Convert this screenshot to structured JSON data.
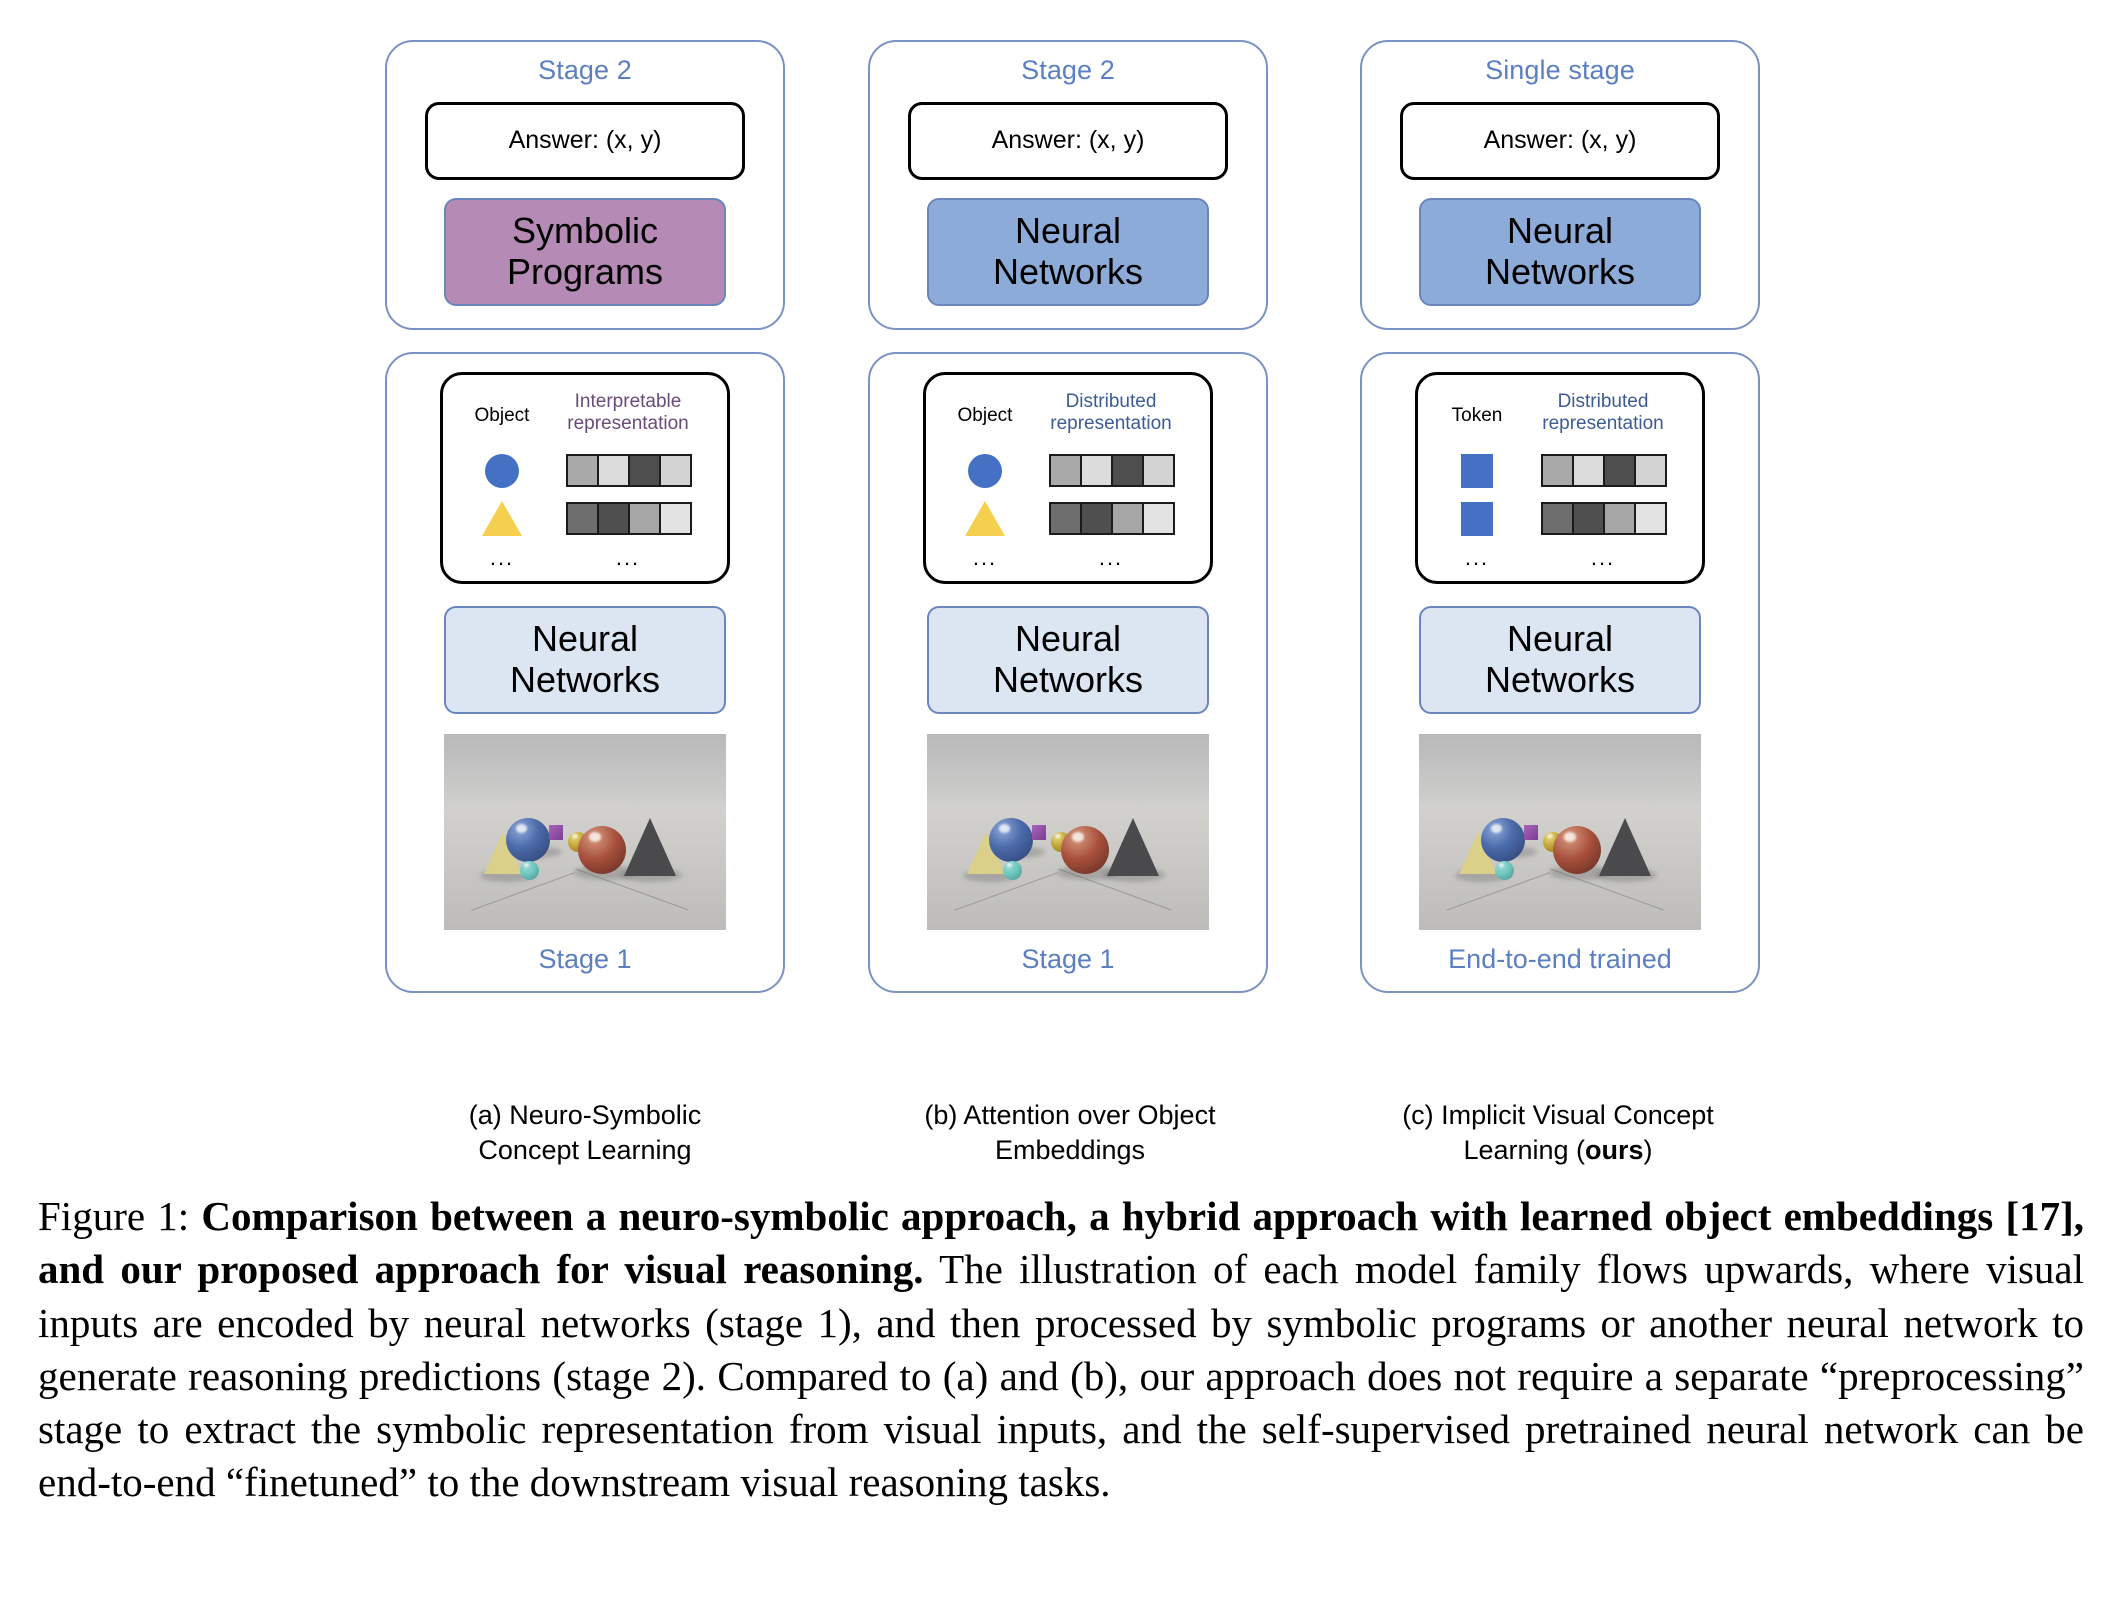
{
  "figure": {
    "label": "Figure 1:",
    "caption_bold": "Comparison between a neuro-symbolic approach, a hybrid approach with learned object embeddings [17], and our proposed approach for visual reasoning.",
    "caption_rest": " The illustration of each model family flows upwards, where visual inputs are encoded by neural networks (stage 1), and then processed by symbolic programs or another neural network to generate reasoning predictions (stage 2). Compared to (a) and (b), our approach does not require a separate “preprocessing” stage to extract the symbolic representation from visual inputs, and the self-supervised pretrained neural network can be end-to-end “finetuned” to the downstream visual reasoning tasks."
  },
  "colors": {
    "stage_label": "#5b7fc0",
    "outer_border": "#7a93c4",
    "symbolic_fill": "#b58ab4",
    "neural_dark_fill": "#8cabd9",
    "neural_light_fill": "#dce6f3",
    "interpretable_text": "#6b4b78",
    "distributed_text": "#3c5c93",
    "token_blue": "#4471c4",
    "object_circle": "#4471c4",
    "object_triangle": "#f5cf4e"
  },
  "panels": [
    {
      "id": "a",
      "top_stage_label": "Stage 2",
      "answer_label": "Answer: (x, y)",
      "processor_label": "Symbolic\nPrograms",
      "processor_line1": "Symbolic",
      "processor_line2": "Programs",
      "repr_col_left_header": "Object",
      "repr_col_right_header_line1": "Interpretable",
      "repr_col_right_header_line2": "representation",
      "object_glyphs": [
        "circle",
        "triangle"
      ],
      "repr_rows": [
        [
          "#a9a9a9",
          "#dcdcdc",
          "#4e4e4e",
          "#d3d3d3"
        ],
        [
          "#6e6e6e",
          "#4f4f4f",
          "#a6a6a6",
          "#e3e3e3"
        ]
      ],
      "ellipsis_left": "...",
      "ellipsis_right": "...",
      "encoder_line1": "Neural",
      "encoder_line2": "Networks",
      "bottom_stage_label": "Stage 1",
      "subcaption_line1": "(a) Neuro-Symbolic",
      "subcaption_line2": "Concept Learning",
      "subcaption_bold_tail": ""
    },
    {
      "id": "b",
      "top_stage_label": "Stage 2",
      "answer_label": "Answer: (x, y)",
      "processor_label": "Neural\nNetworks",
      "processor_line1": "Neural",
      "processor_line2": "Networks",
      "repr_col_left_header": "Object",
      "repr_col_right_header_line1": "Distributed",
      "repr_col_right_header_line2": "representation",
      "object_glyphs": [
        "circle",
        "triangle"
      ],
      "repr_rows": [
        [
          "#a9a9a9",
          "#dcdcdc",
          "#4e4e4e",
          "#d3d3d3"
        ],
        [
          "#6e6e6e",
          "#4f4f4f",
          "#a6a6a6",
          "#e3e3e3"
        ]
      ],
      "ellipsis_left": "...",
      "ellipsis_right": "...",
      "encoder_line1": "Neural",
      "encoder_line2": "Networks",
      "bottom_stage_label": "Stage 1",
      "subcaption_line1": "(b) Attention over Object",
      "subcaption_line2": "Embeddings",
      "subcaption_bold_tail": ""
    },
    {
      "id": "c",
      "top_stage_label": "Single stage",
      "answer_label": "Answer: (x, y)",
      "processor_label": "Neural\nNetworks",
      "processor_line1": "Neural",
      "processor_line2": "Networks",
      "repr_col_left_header": "Token",
      "repr_col_right_header_line1": "Distributed",
      "repr_col_right_header_line2": "representation",
      "object_glyphs": [
        "square",
        "square"
      ],
      "repr_rows": [
        [
          "#a9a9a9",
          "#dcdcdc",
          "#4e4e4e",
          "#d3d3d3"
        ],
        [
          "#6e6e6e",
          "#4f4f4f",
          "#a6a6a6",
          "#e3e3e3"
        ]
      ],
      "ellipsis_left": "...",
      "ellipsis_right": "...",
      "encoder_line1": "Neural",
      "encoder_line2": "Networks",
      "bottom_stage_label": "End-to-end trained",
      "subcaption_line1": "(c) Implicit Visual Concept",
      "subcaption_line2": "Learning (",
      "subcaption_bold_tail": "ours",
      "subcaption_line2_end": ")"
    }
  ],
  "scene": {
    "name": "clevr-scene",
    "objects": [
      {
        "name": "yellow-cone",
        "color": "#d9cf84"
      },
      {
        "name": "blue-metal-sphere",
        "color": "#4a6aa8"
      },
      {
        "name": "purple-small-cube",
        "color": "#8d4aa0"
      },
      {
        "name": "gold-small-sphere",
        "color": "#c2a535"
      },
      {
        "name": "cyan-small-sphere",
        "color": "#6fc6c0"
      },
      {
        "name": "copper-metal-sphere",
        "color": "#a8503c"
      },
      {
        "name": "gray-metal-cone",
        "color": "#4a4a4c"
      }
    ]
  }
}
